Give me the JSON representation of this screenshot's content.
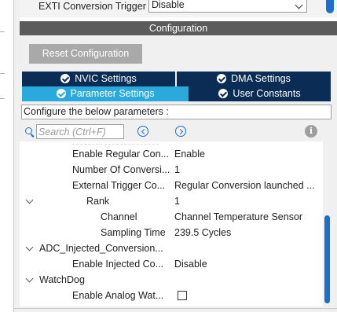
{
  "exti": {
    "label": "EXTI Conversion Trigger",
    "value": "Disable"
  },
  "configuration": {
    "header": "Configuration",
    "reset_button": "Reset Configuration",
    "tabs": [
      {
        "label": "NVIC Settings"
      },
      {
        "label": "DMA Settings"
      },
      {
        "label": "Parameter Settings"
      },
      {
        "label": "User Constants"
      }
    ],
    "configure_text": "Configure the below parameters :",
    "search_placeholder": "Search (Ctrl+F)",
    "info_glyph": "i"
  },
  "params": [
    {
      "name": "Enable Regular Con...",
      "value": "Enable"
    },
    {
      "name": "Number Of Conversi...",
      "value": "1"
    },
    {
      "name": "External Trigger Co...",
      "value": "Regular Conversion launched ..."
    },
    {
      "name": "Rank",
      "value": "1"
    },
    {
      "name": "Channel",
      "value": "Channel Temperature Sensor"
    },
    {
      "name": "Sampling Time",
      "value": "239.5 Cycles"
    },
    {
      "name": "ADC_Injected_Conversion..."
    },
    {
      "name": "Enable Injected Co...",
      "value": "Disable"
    },
    {
      "name": "WatchDog"
    },
    {
      "name": "Enable Analog Wat...",
      "checked": false
    }
  ],
  "colors": {
    "accent": "#2aa9dd",
    "tab_dark": "#0b2c54",
    "scroll": "#1b6fd1",
    "header_bg": "#5b5b5b"
  }
}
